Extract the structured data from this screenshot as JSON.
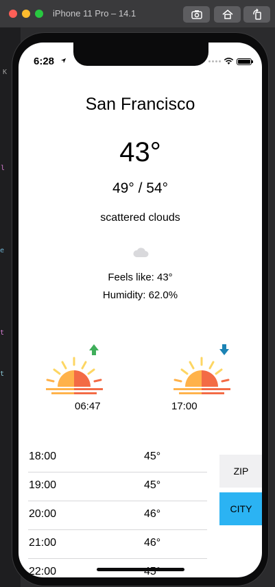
{
  "simulator": {
    "title": "iPhone 11 Pro – 14.1",
    "buttons": [
      "screenshot-icon",
      "home-icon",
      "rotate-icon"
    ]
  },
  "status_bar": {
    "time": "6:28"
  },
  "weather": {
    "city": "San Francisco",
    "temperature": "43°",
    "hi_lo": "49° / 54°",
    "description": "scattered clouds",
    "feels_like": "Feels like: 43°",
    "humidity": "Humidity: 62.0%"
  },
  "sun": {
    "sunrise": "06:47",
    "sunset": "17:00"
  },
  "forecast": [
    {
      "hour": "18:00",
      "temp": "45°"
    },
    {
      "hour": "19:00",
      "temp": "45°"
    },
    {
      "hour": "20:00",
      "temp": "46°"
    },
    {
      "hour": "21:00",
      "temp": "46°"
    },
    {
      "hour": "22:00",
      "temp": "45°"
    }
  ],
  "buttons": {
    "zip": "ZIP",
    "city": "CITY"
  },
  "colors": {
    "city_button": "#2bb3f3",
    "zip_button": "#f0f0f2",
    "sunrise_arrow": "#3fae5a",
    "sunset_arrow": "#1c83b4"
  }
}
